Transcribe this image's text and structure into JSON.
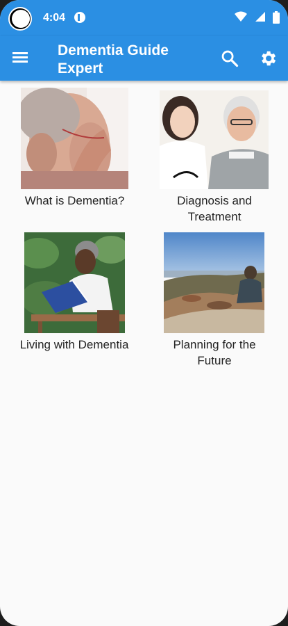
{
  "status_bar": {
    "time": "4:04"
  },
  "app_bar": {
    "title": "Dementia Guide Expert",
    "menu_icon": "hamburger-menu-icon",
    "search_icon": "search-icon",
    "settings_icon": "gear-icon"
  },
  "topics": [
    {
      "label": "What is Dementia?",
      "image": "elderly woman holding hand to head"
    },
    {
      "label": "Diagnosis and Treatment",
      "image": "nurse with smiling elderly man"
    },
    {
      "label": "Living with Dementia",
      "image": "woman reading a blue book outdoors"
    },
    {
      "label": "Planning for the Future",
      "image": "person sitting on a rocky mountain top"
    }
  ],
  "colors": {
    "primary": "#2b8fe3",
    "background": "#fafafa",
    "text": "#222222"
  }
}
